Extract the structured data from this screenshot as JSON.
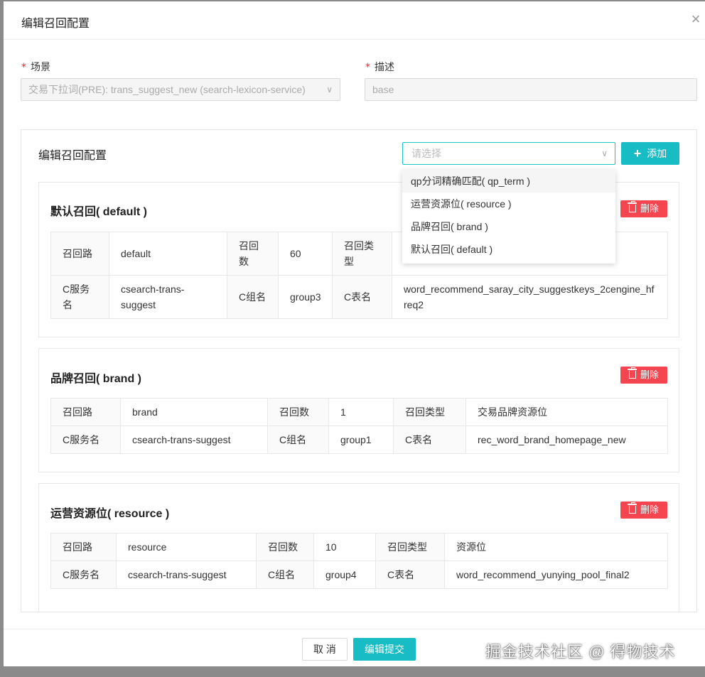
{
  "modal": {
    "title": "编辑召回配置",
    "close_glyph": "×"
  },
  "form": {
    "scene_label": "场景",
    "scene_value": "交易下拉词(PRE): trans_suggest_new (search-lexicon-service)",
    "desc_label": "描述",
    "desc_value": "base",
    "required_mark": "*"
  },
  "panel": {
    "title": "编辑召回配置",
    "select_placeholder": "请选择",
    "add_label": "添加",
    "dropdown_options": [
      "qp分词精确匹配( qp_term )",
      "运营资源位( resource )",
      "品牌召回( brand )",
      "默认召回( default )"
    ]
  },
  "delete_label": "删除",
  "cards": [
    {
      "title": "默认召回( default )",
      "row1": [
        "召回路",
        "default",
        "召回数",
        "60",
        "召回类型",
        ""
      ],
      "row2": [
        "C服务名",
        "csearch-trans-suggest",
        "C组名",
        "group3",
        "C表名",
        "word_recommend_saray_city_suggestkeys_2cengine_hfreq2"
      ]
    },
    {
      "title": "品牌召回( brand )",
      "row1": [
        "召回路",
        "brand",
        "召回数",
        "1",
        "召回类型",
        "交易品牌资源位"
      ],
      "row2": [
        "C服务名",
        "csearch-trans-suggest",
        "C组名",
        "group1",
        "C表名",
        "rec_word_brand_homepage_new"
      ]
    },
    {
      "title": "运营资源位( resource )",
      "row1": [
        "召回路",
        "resource",
        "召回数",
        "10",
        "召回类型",
        "资源位"
      ],
      "row2": [
        "C服务名",
        "csearch-trans-suggest",
        "C组名",
        "group4",
        "C表名",
        "word_recommend_yunying_pool_final2"
      ]
    }
  ],
  "footer": {
    "cancel_label": "取 消",
    "submit_label": "编辑提交",
    "watermark": "掘金技术社区 @ 得物技术"
  },
  "colors": {
    "accent": "#17bcc4",
    "danger": "#f5454f",
    "required": "#f5222d"
  }
}
